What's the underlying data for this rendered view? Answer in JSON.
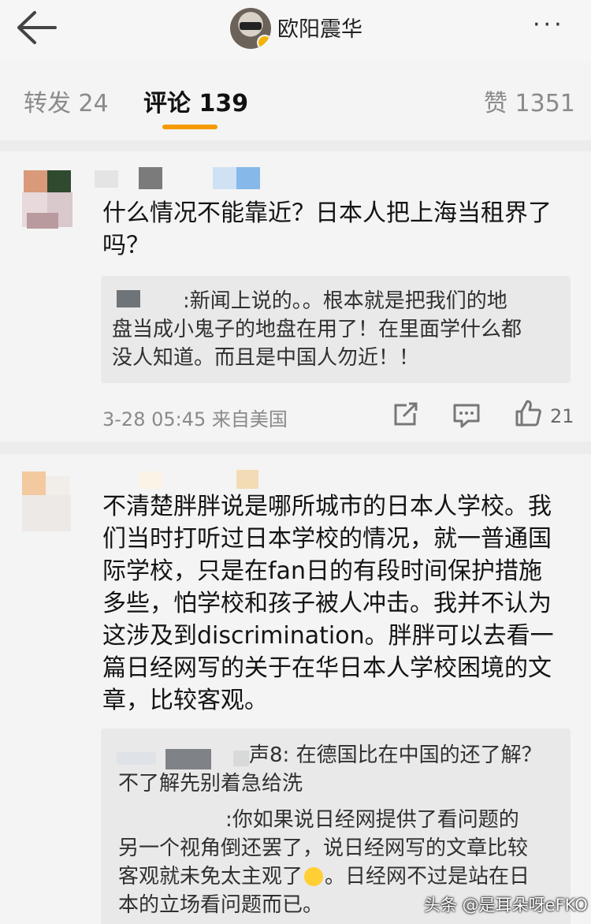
{
  "header": {
    "author": "欧阳震华",
    "more": "···"
  },
  "tabs": {
    "repost": "转发 24",
    "comments": "评论 139",
    "likes": "赞 1351"
  },
  "comments": [
    {
      "text_lines": [
        "什么情况不能靠近？日本人把上海当租界了",
        "吗？"
      ],
      "reply_lines": [
        ":新闻上说的。。根本就是把我们的地",
        "盘当成小鬼子的地盘在用了！在里面学什么都",
        "没人知道。而且是中国人勿近！！"
      ],
      "time": "3-28 05:45",
      "source": "来自美国",
      "like_count": "21"
    },
    {
      "text_lines": [
        "不清楚胖胖说是哪所城市的日本人学校。我",
        "们当时打听过日本学校的情况，就一普通国",
        "际学校，只是在fan日的有段时间保护措施",
        "多些，怕学校和孩子被人冲击。我并不认为",
        "这涉及到discrimination。胖胖可以去看一",
        "篇日经网写的关于在华日本人学校困境的文",
        "章，比较客观。"
      ],
      "reply1_lines": [
        "声8: 在德国比在中国的还了解？",
        "不了解先别着急给洗"
      ],
      "reply2_lines": [
        ":你如果说日经网提供了看问题的",
        "另一个视角倒还罢了，说日经网写的文章比较",
        "客观就未免太主观了",
        "。日经网不过是站在日",
        "本的立场看问题而已。"
      ]
    }
  ],
  "watermark": "头条 @是耳朵呀eFKO",
  "icons": [
    "back-arrow-icon",
    "more-dots-icon",
    "verified-badge-icon",
    "share-icon",
    "comment-icon",
    "thumbs-up-icon",
    "laughing-emoji-icon"
  ],
  "colors": {
    "accent": "#f59a00",
    "background": "#f4f4f4",
    "quote_bg": "#e9e9e9"
  }
}
